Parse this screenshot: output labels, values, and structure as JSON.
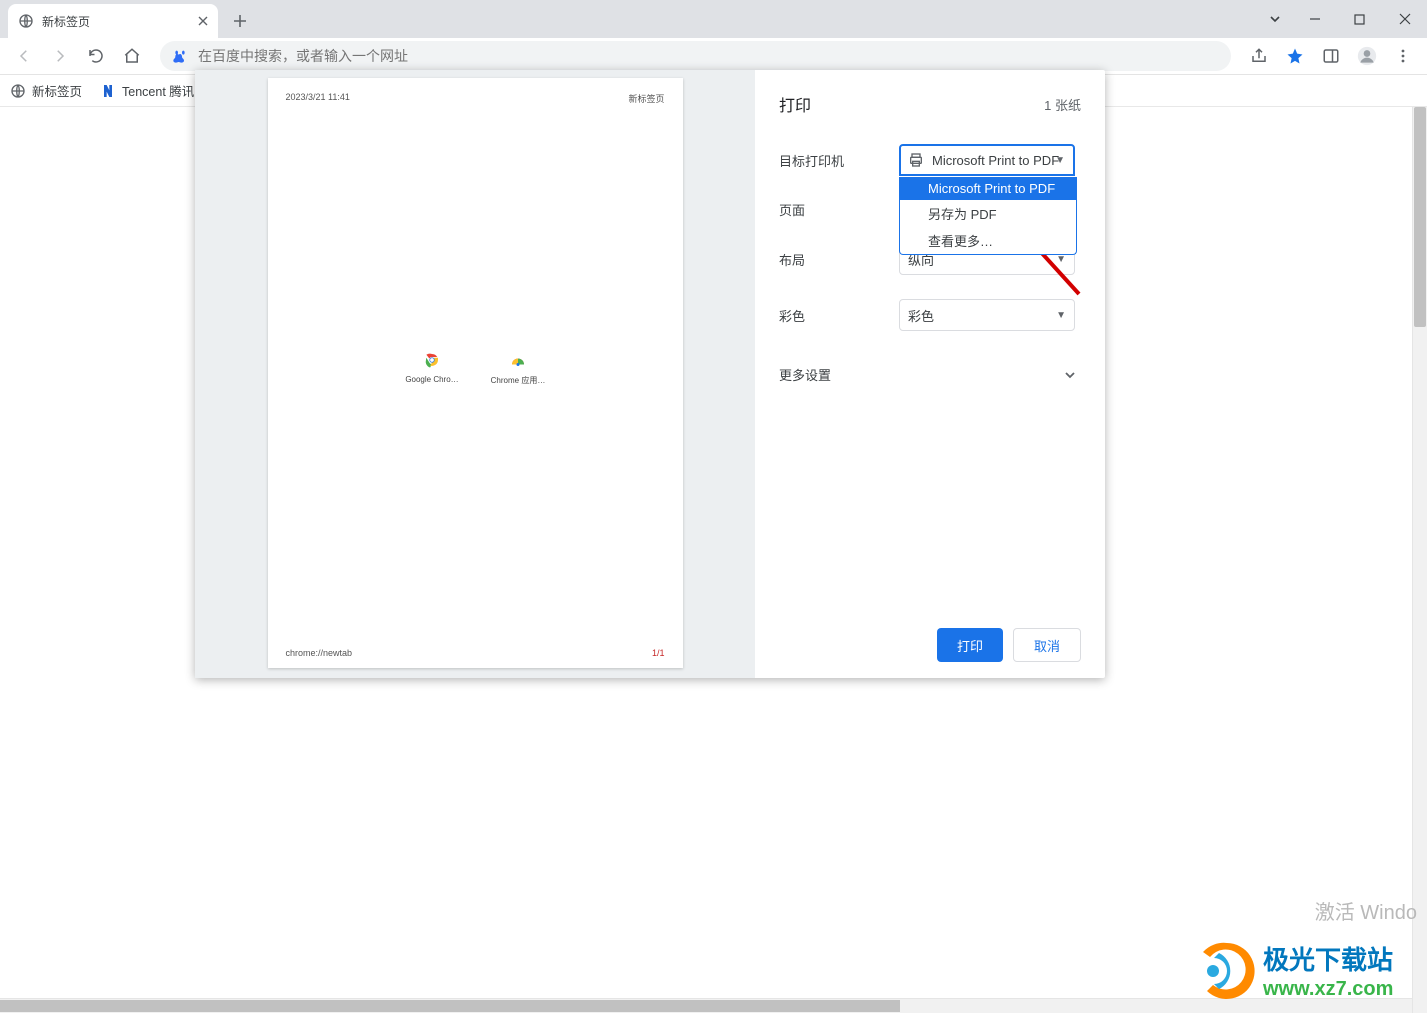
{
  "tab": {
    "title": "新标签页"
  },
  "omnibox": {
    "placeholder": "在百度中搜索，或者输入一个网址"
  },
  "bookmarks": [
    {
      "label": "新标签页",
      "icon": "globe"
    },
    {
      "label": "Tencent 腾讯",
      "icon": "tencent"
    }
  ],
  "print": {
    "title": "打印",
    "sheet_count": "1 张纸",
    "rows": {
      "destination": {
        "label": "目标打印机",
        "value": "Microsoft Print to PDF",
        "options": [
          "Microsoft Print to PDF",
          "另存为 PDF",
          "查看更多…"
        ]
      },
      "pages": {
        "label": "页面"
      },
      "layout": {
        "label": "布局",
        "value": "纵向"
      },
      "color": {
        "label": "彩色",
        "value": "彩色"
      }
    },
    "more": "更多设置",
    "actions": {
      "print": "打印",
      "cancel": "取消"
    }
  },
  "preview": {
    "date": "2023/3/21 11:41",
    "title": "新标签页",
    "tiles": [
      {
        "label": "Google Chro…"
      },
      {
        "label": "Chrome 应用…"
      }
    ],
    "url": "chrome://newtab",
    "page": "1/1"
  },
  "watermark": {
    "activate": "激活 Windo",
    "site_name": "极光下载站",
    "site_url": "www.xz7.com"
  }
}
